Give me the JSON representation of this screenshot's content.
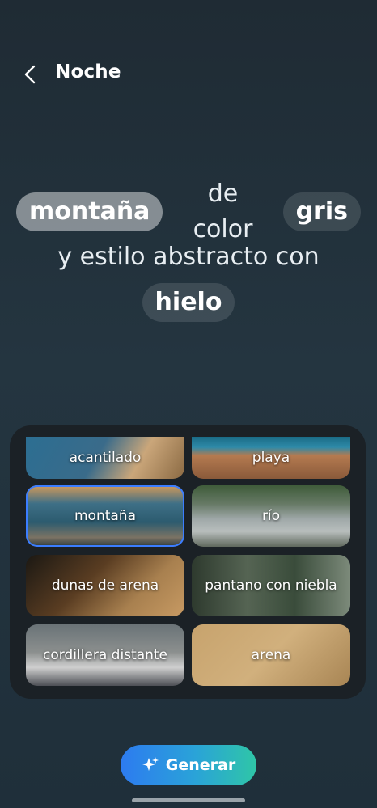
{
  "header": {
    "title": "Noche",
    "back_icon": "chevron-left-icon"
  },
  "prompt": {
    "chip_subject": "montaña",
    "text1": "de color",
    "chip_color": "gris",
    "text2": "y estilo abstracto con",
    "chip_extra": "hielo"
  },
  "options": [
    {
      "label": "acantilado"
    },
    {
      "label": "playa"
    },
    {
      "label": "montaña",
      "selected": true
    },
    {
      "label": "río"
    },
    {
      "label": "dunas de arena"
    },
    {
      "label": "pantano con niebla"
    },
    {
      "label": "cordillera distante"
    },
    {
      "label": "arena"
    }
  ],
  "generate": {
    "label": "Generar",
    "icon": "sparkle-icon"
  },
  "colors": {
    "accent_selected": "#3b7dff",
    "button_start": "#2d7bf0",
    "button_end": "#2fc6a7"
  }
}
